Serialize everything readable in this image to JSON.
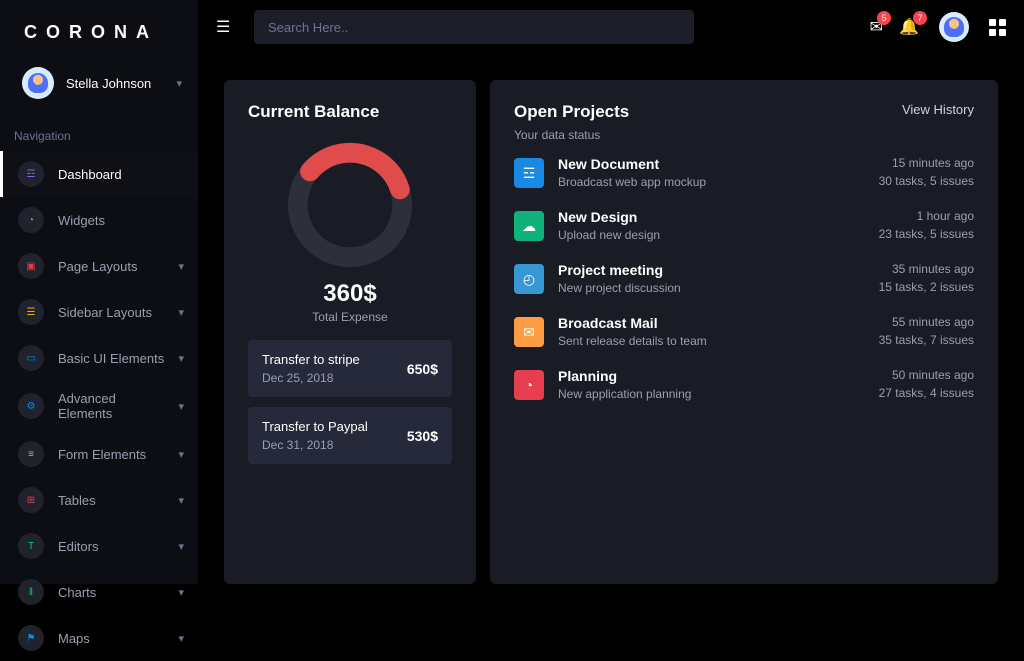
{
  "logo": "CORONA",
  "user": {
    "name": "Stella Johnson"
  },
  "section_label": "Navigation",
  "search": {
    "placeholder": "Search Here.."
  },
  "topbar": {
    "mail_count": "5",
    "bell_count": "7"
  },
  "nav": [
    {
      "key": "dashboard",
      "label": "Dashboard",
      "color": "#8f5fe8",
      "glyph": "☲",
      "active": true,
      "expandable": false
    },
    {
      "key": "widgets",
      "label": "Widgets",
      "color": "#ff6b6b",
      "glyph": "◔",
      "active": false,
      "expandable": false
    },
    {
      "key": "layouts",
      "label": "Page Layouts",
      "color": "#e43d4e",
      "glyph": "▣",
      "active": false,
      "expandable": true
    },
    {
      "key": "sidebar",
      "label": "Sidebar Layouts",
      "color": "#ffab00",
      "glyph": "☰",
      "active": false,
      "expandable": true
    },
    {
      "key": "basic",
      "label": "Basic UI Elements",
      "color": "#0090e7",
      "glyph": "▭",
      "active": false,
      "expandable": true
    },
    {
      "key": "advanced",
      "label": "Advanced Elements",
      "color": "#0090e7",
      "glyph": "⚙",
      "active": false,
      "expandable": true
    },
    {
      "key": "forms",
      "label": "Form Elements",
      "color": "#f3a83c",
      "glyph": "≡",
      "active": false,
      "expandable": true
    },
    {
      "key": "tables",
      "label": "Tables",
      "color": "#e43d4e",
      "glyph": "⊞",
      "active": false,
      "expandable": true
    },
    {
      "key": "editors",
      "label": "Editors",
      "color": "#00d25b",
      "glyph": "T",
      "active": false,
      "expandable": true
    },
    {
      "key": "charts",
      "label": "Charts",
      "color": "#00d25b",
      "glyph": "‖",
      "active": false,
      "expandable": true
    },
    {
      "key": "maps",
      "label": "Maps",
      "color": "#0090e7",
      "glyph": "⚑",
      "active": false,
      "expandable": true
    }
  ],
  "balance": {
    "title": "Current Balance",
    "amount": "360$",
    "sub": "Total Expense",
    "donut": {
      "used": 34
    },
    "transfers": [
      {
        "title": "Transfer to stripe",
        "date": "Dec 25, 2018",
        "amount": "650$"
      },
      {
        "title": "Transfer to Paypal",
        "date": "Dec 31, 2018",
        "amount": "530$"
      }
    ]
  },
  "projects": {
    "title": "Open Projects",
    "sub": "Your data status",
    "view": "View History",
    "items": [
      {
        "title": "New Document",
        "desc": "Broadcast web app mockup",
        "time": "15 minutes ago",
        "meta": "30 tasks, 5 issues",
        "color": "c-blue",
        "glyph": "☲"
      },
      {
        "title": "New Design",
        "desc": "Upload new design",
        "time": "1 hour ago",
        "meta": "23 tasks, 5 issues",
        "color": "c-green",
        "glyph": "☁"
      },
      {
        "title": "Project meeting",
        "desc": "New project discussion",
        "time": "35 minutes ago",
        "meta": "15 tasks, 2 issues",
        "color": "c-cyan",
        "glyph": "◴"
      },
      {
        "title": "Broadcast Mail",
        "desc": "Sent release details to team",
        "time": "55 minutes ago",
        "meta": "35 tasks, 7 issues",
        "color": "c-orange",
        "glyph": "✉"
      },
      {
        "title": "Planning",
        "desc": "New application planning",
        "time": "50 minutes ago",
        "meta": "27 tasks, 4 issues",
        "color": "c-red",
        "glyph": "◔"
      }
    ]
  },
  "chart_data": {
    "type": "pie",
    "title": "Total Expense",
    "series": [
      {
        "name": "used",
        "value": 34,
        "color": "#e04c4c"
      },
      {
        "name": "remaining",
        "value": 66,
        "color": "#2e2f3a"
      }
    ]
  }
}
